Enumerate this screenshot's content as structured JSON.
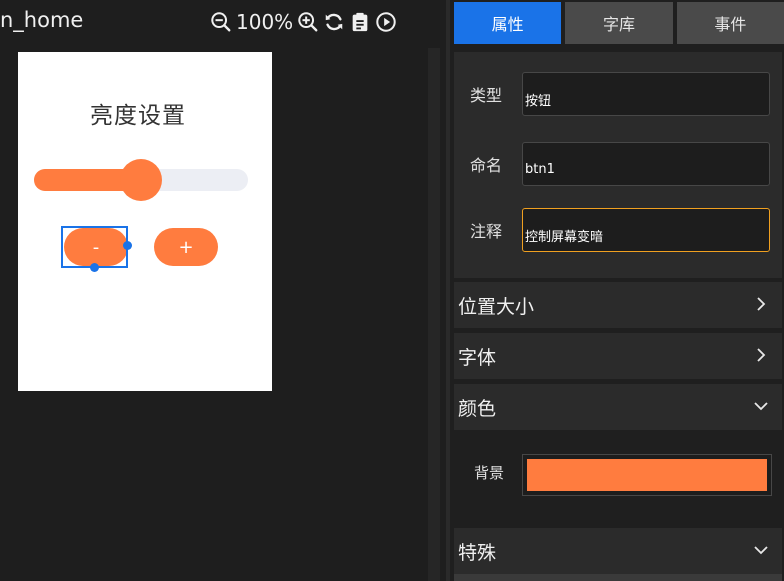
{
  "editor": {
    "page_name": "n_home",
    "zoom": "100%",
    "toolbar_icons": [
      "zoom-out-icon",
      "zoom-in-icon",
      "refresh-icon",
      "clipboard-icon",
      "play-icon"
    ]
  },
  "canvas": {
    "title": "亮度设置",
    "slider": {
      "value_fraction": 0.5
    },
    "buttons": {
      "minus_label": "-",
      "plus_label": "+"
    },
    "accent_color": "#ff7c3f",
    "selection_color": "#1a73e8"
  },
  "panel": {
    "tabs": [
      {
        "label": "属性",
        "active": true
      },
      {
        "label": "字库",
        "active": false
      },
      {
        "label": "事件",
        "active": false
      }
    ],
    "attributes": {
      "type": {
        "label": "类型",
        "value": "按钮"
      },
      "name": {
        "label": "命名",
        "value": "btn1"
      },
      "comment": {
        "label": "注释",
        "value": "控制屏幕变暗"
      }
    },
    "sections": {
      "position_size": "位置大小",
      "font": "字体",
      "color": "颜色",
      "special": "特殊"
    },
    "color": {
      "background_label": "背景",
      "background_value": "#ff7c3f"
    }
  }
}
